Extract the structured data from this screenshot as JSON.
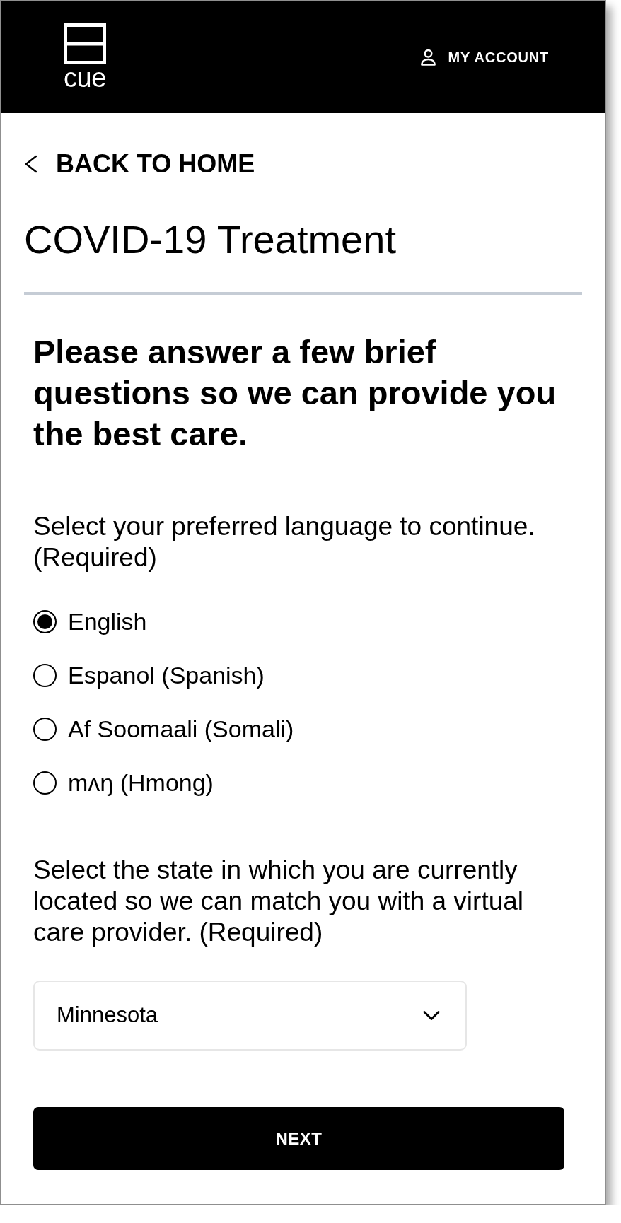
{
  "header": {
    "logo_text": "cue",
    "account_link": "MY ACCOUNT"
  },
  "back_link": "BACK TO HOME",
  "page_title": "COVID-19 Treatment",
  "form": {
    "heading": "Please answer a few brief questions so we can provide you the best care.",
    "language_prompt": "Select your preferred language to continue. (Required)",
    "languages": [
      {
        "label": "English",
        "selected": true
      },
      {
        "label": "Espanol (Spanish)",
        "selected": false
      },
      {
        "label": "Af Soomaali (Somali)",
        "selected": false
      },
      {
        "label": "mʌŋ (Hmong)",
        "selected": false
      }
    ],
    "state_prompt": "Select the state in which you are currently located so we can match you with a virtual care provider. (Required)",
    "state_select": {
      "value": "Minnesota"
    },
    "next_button": "NEXT"
  }
}
